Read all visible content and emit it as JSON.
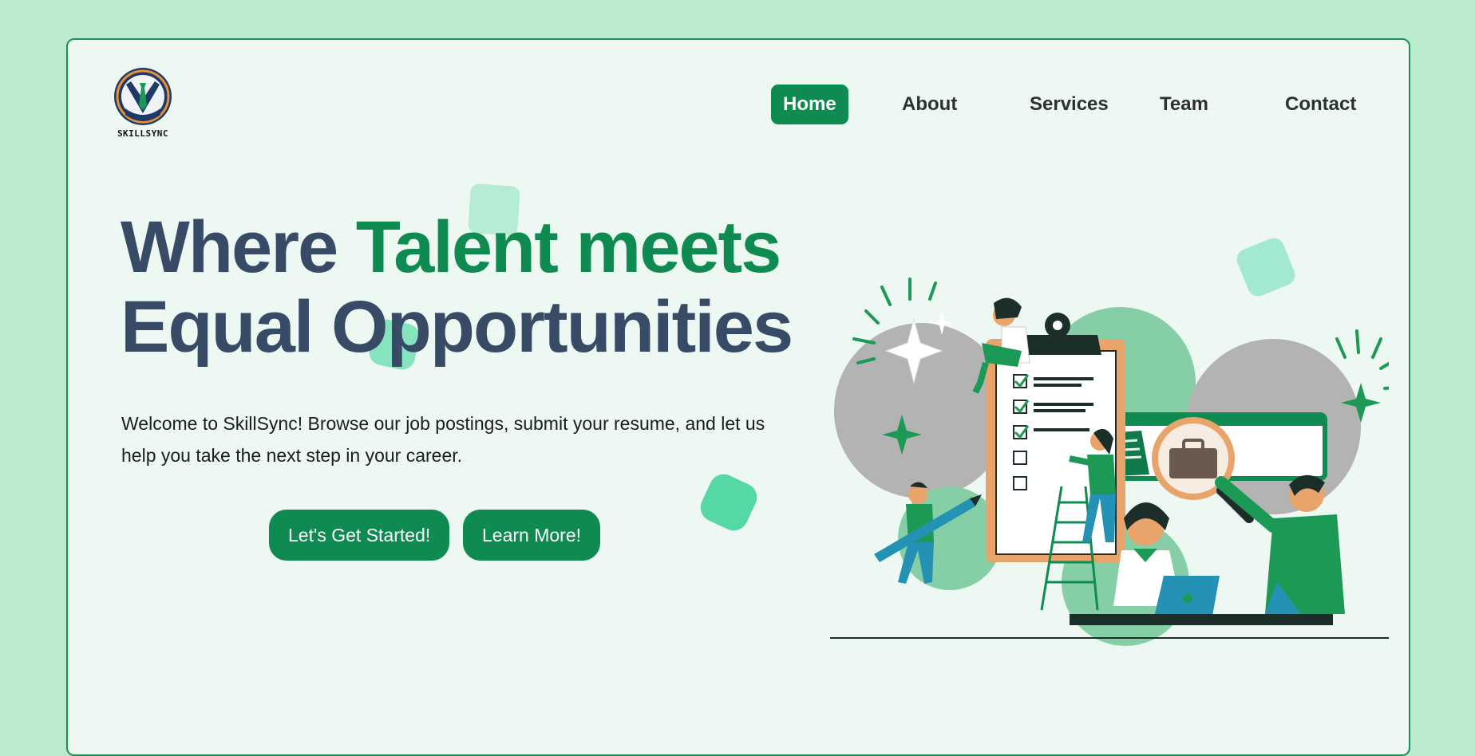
{
  "brand": {
    "logo_text": "SKILLSYNC"
  },
  "nav": {
    "items": [
      {
        "label": "Home",
        "active": true
      },
      {
        "label": "About",
        "active": false
      },
      {
        "label": "Services",
        "active": false
      },
      {
        "label": "Team",
        "active": false
      },
      {
        "label": "Contact",
        "active": false
      }
    ]
  },
  "hero": {
    "title_part1": "Where ",
    "title_accent": "Talent meets",
    "title_line2": "Equal Opportunities",
    "intro": "Welcome to SkillSync! Browse our job postings, submit your resume, and let us help you take the next step in your career.",
    "primary_button": "Let's Get Started!",
    "secondary_button": "Learn More!"
  },
  "colors": {
    "page_background": "#b9ebcc",
    "card_background": "#edf8f3",
    "accent": "#0f8a51",
    "heading": "#374a66"
  },
  "icons": [
    "skillsync-logo",
    "hiring-illustration"
  ]
}
